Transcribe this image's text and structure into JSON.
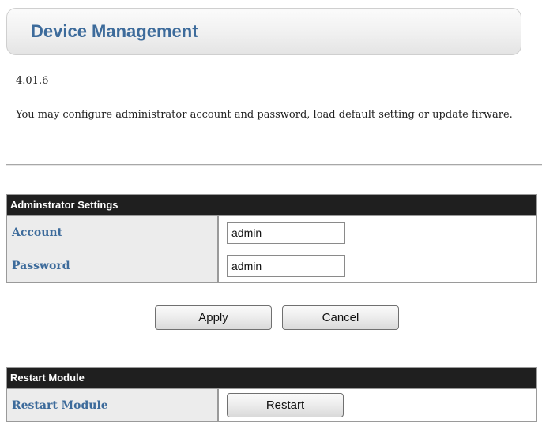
{
  "header": {
    "title": "Device Management"
  },
  "version": "4.01.6",
  "description": "You may configure administrator account and password, load default setting or update firware.",
  "admin_settings": {
    "header": "Adminstrator Settings",
    "rows": [
      {
        "label": "Account",
        "value": "admin"
      },
      {
        "label": "Password",
        "value": "admin"
      }
    ]
  },
  "actions": {
    "apply_label": "Apply",
    "cancel_label": "Cancel"
  },
  "restart_module": {
    "header": "Restart Module",
    "row_label": "Restart Module",
    "button_label": "Restart"
  },
  "colors": {
    "title_blue": "#3d6b9b",
    "header_bg": "#1f1f1f",
    "label_bg": "#ececec"
  }
}
